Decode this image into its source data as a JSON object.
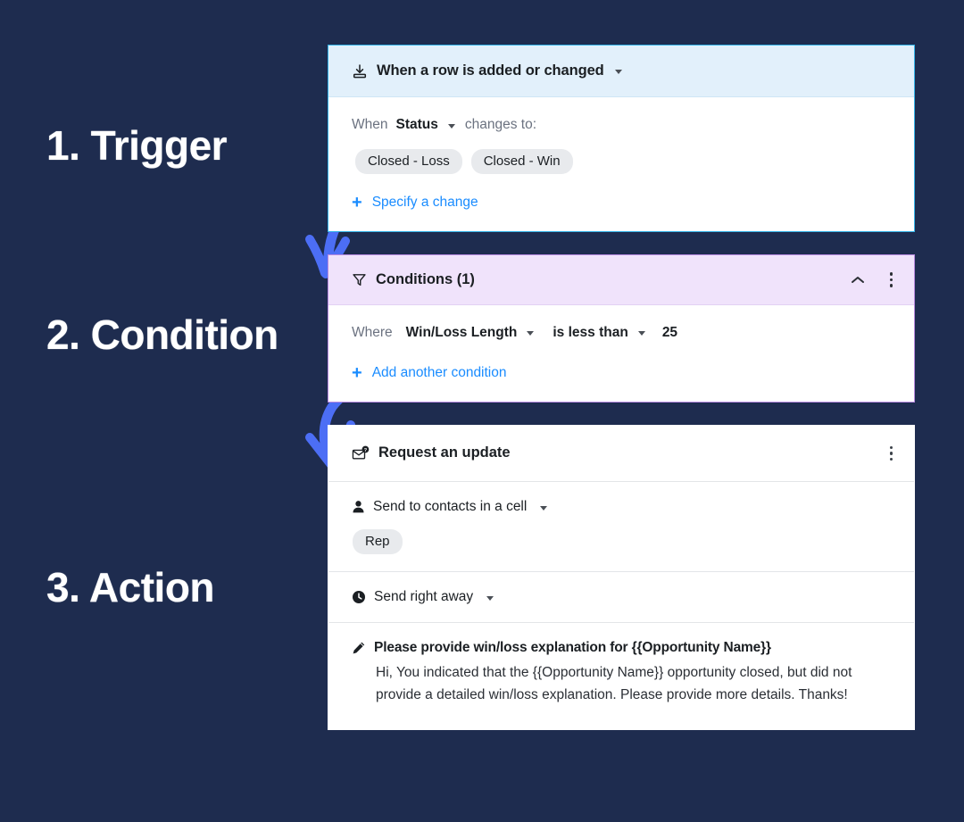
{
  "theme": {
    "background": "#1e2c4f",
    "accent_link": "#1a8cff",
    "arrow_color": "#4c6ef5",
    "trigger_header_bg": "#e2f0fb",
    "trigger_border": "#35b4e8",
    "condition_header_bg": "#f0e3fb",
    "condition_border": "#b88ae0",
    "chip_bg": "#e8eaed",
    "card_bg": "#ffffff"
  },
  "steps": [
    {
      "id": "trigger",
      "label": "1. Trigger"
    },
    {
      "id": "condition",
      "label": "2. Condition"
    },
    {
      "id": "action",
      "label": "3. Action"
    }
  ],
  "trigger": {
    "icon": "add-row-icon",
    "title": "When a row is added or changed",
    "dropdown_icon": "chevron-down-icon",
    "condition_line": {
      "prefix": "When",
      "field": "Status",
      "field_dropdown_icon": "chevron-down-icon",
      "suffix": "changes to:"
    },
    "chips": [
      "Closed - Loss",
      "Closed - Win"
    ],
    "add_link": {
      "icon": "plus-icon",
      "label": "Specify a change"
    }
  },
  "condition": {
    "icon": "filter-icon",
    "title": "Conditions (1)",
    "collapse_icon": "chevron-up-icon",
    "menu_icon": "kebab-menu-icon",
    "rule": {
      "prefix": "Where",
      "field": "Win/Loss Length",
      "field_dropdown_icon": "chevron-down-icon",
      "operator": "is less than",
      "operator_dropdown_icon": "chevron-down-icon",
      "value": "25"
    },
    "add_link": {
      "icon": "plus-icon",
      "label": "Add another condition"
    }
  },
  "action": {
    "icon": "envelope-question-icon",
    "title": "Request an update",
    "menu_icon": "kebab-menu-icon",
    "recipient": {
      "icon": "person-icon",
      "label": "Send to contacts in a cell",
      "dropdown_icon": "chevron-down-icon",
      "chips": [
        "Rep"
      ]
    },
    "timing": {
      "icon": "clock-icon",
      "label": "Send right away",
      "dropdown_icon": "chevron-down-icon"
    },
    "message": {
      "icon": "pencil-icon",
      "subject": "Please provide win/loss explanation for {{Opportunity Name}}",
      "body": "Hi, You indicated that the {{Opportunity Name}} opportunity closed, but did not provide a detailed win/loss explanation. Please provide more details. Thanks!"
    }
  },
  "arrows": [
    {
      "id": "arrow-trigger-to-condition",
      "name": "curved-arrow-icon"
    },
    {
      "id": "arrow-condition-to-action",
      "name": "curved-arrow-icon"
    }
  ]
}
